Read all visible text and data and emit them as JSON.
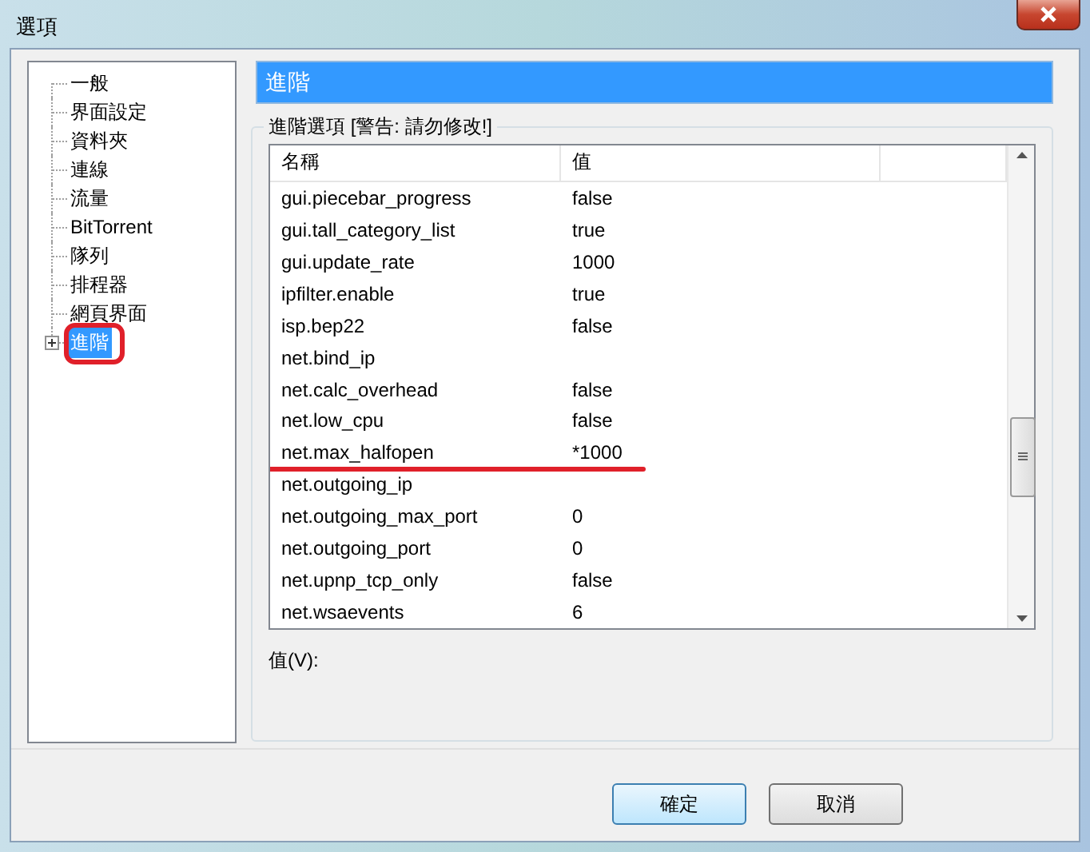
{
  "window": {
    "title": "選項"
  },
  "tree": {
    "items": [
      {
        "label": "一般",
        "selected": false,
        "expandable": false,
        "marked": false
      },
      {
        "label": "界面設定",
        "selected": false,
        "expandable": false,
        "marked": false
      },
      {
        "label": "資料夾",
        "selected": false,
        "expandable": false,
        "marked": false
      },
      {
        "label": "連線",
        "selected": false,
        "expandable": false,
        "marked": false
      },
      {
        "label": "流量",
        "selected": false,
        "expandable": false,
        "marked": false
      },
      {
        "label": "BitTorrent",
        "selected": false,
        "expandable": false,
        "marked": false
      },
      {
        "label": "隊列",
        "selected": false,
        "expandable": false,
        "marked": false
      },
      {
        "label": "排程器",
        "selected": false,
        "expandable": false,
        "marked": false
      },
      {
        "label": "網頁界面",
        "selected": false,
        "expandable": false,
        "marked": false
      },
      {
        "label": "進階",
        "selected": true,
        "expandable": true,
        "marked": true
      }
    ]
  },
  "header": {
    "title": "進階"
  },
  "group": {
    "title": "進階選項 [警告: 請勿修改!]"
  },
  "table": {
    "columns": [
      "名稱",
      "值"
    ],
    "rows": [
      {
        "name": "gui.piecebar_progress",
        "value": "false",
        "marked": false
      },
      {
        "name": "gui.tall_category_list",
        "value": "true",
        "marked": false
      },
      {
        "name": "gui.update_rate",
        "value": "1000",
        "marked": false
      },
      {
        "name": "ipfilter.enable",
        "value": "true",
        "marked": false
      },
      {
        "name": "isp.bep22",
        "value": "false",
        "marked": false
      },
      {
        "name": "net.bind_ip",
        "value": "",
        "marked": false
      },
      {
        "name": "net.calc_overhead",
        "value": "false",
        "marked": false
      },
      {
        "name": "net.low_cpu",
        "value": "false",
        "marked": false
      },
      {
        "name": "net.max_halfopen",
        "value": "*1000",
        "marked": true
      },
      {
        "name": "net.outgoing_ip",
        "value": "",
        "marked": false
      },
      {
        "name": "net.outgoing_max_port",
        "value": "0",
        "marked": false
      },
      {
        "name": "net.outgoing_port",
        "value": "0",
        "marked": false
      },
      {
        "name": "net.upnp_tcp_only",
        "value": "false",
        "marked": false
      },
      {
        "name": "net.wsaevents",
        "value": "6",
        "marked": false
      }
    ]
  },
  "value_label": "值(V):",
  "buttons": [
    {
      "label": "確定",
      "default": true
    },
    {
      "label": "取消",
      "default": false
    }
  ]
}
